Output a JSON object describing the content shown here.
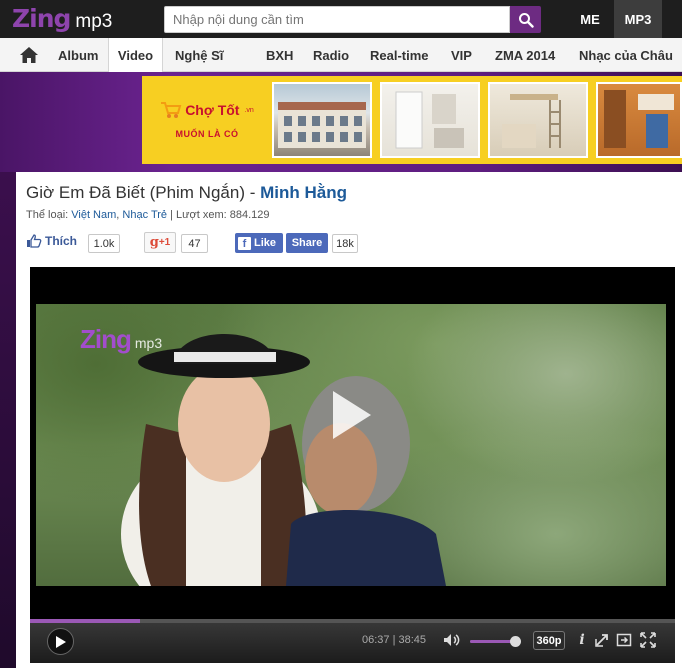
{
  "header": {
    "logo_brand": "Zing",
    "logo_product": "mp3",
    "search_placeholder": "Nhập nội dung cần tìm",
    "tabs": [
      {
        "label": "ME"
      },
      {
        "label": "MP3",
        "active": true
      }
    ]
  },
  "nav": {
    "items": [
      {
        "label": "Album"
      },
      {
        "label": "Video",
        "active": true
      },
      {
        "label": "Nghệ Sĩ"
      },
      {
        "label": "BXH"
      },
      {
        "label": "Radio"
      },
      {
        "label": "Real-time"
      },
      {
        "label": "VIP"
      },
      {
        "label": "ZMA 2014"
      },
      {
        "label": "Nhạc của Châu"
      }
    ]
  },
  "ad": {
    "brand": "Chợ Tốt",
    "brand_suffix": ".vn",
    "tagline": "MUỐN LÀ CÓ"
  },
  "video": {
    "title": "Giờ Em Đã Biết (Phim Ngắn)",
    "separator": " - ",
    "artist": "Minh Hằng",
    "meta_category_label": "Thể loại: ",
    "meta_categories": [
      "Việt Nam",
      "Nhạc Trẻ"
    ],
    "meta_category_sep": ", ",
    "meta_views_label": " | Lượt xem: ",
    "meta_views": "884.129"
  },
  "social": {
    "like_label": "Thích",
    "like_count": "1.0k",
    "gplus_label": "+1",
    "gplus_count": "47",
    "fb_like_label": "Like",
    "fb_share_label": "Share",
    "fb_count": "18k"
  },
  "player": {
    "watermark_brand": "Zing",
    "watermark_product": "mp3",
    "current_time": "06:37",
    "total_time": "38:45",
    "progress": 0.171,
    "volume": 0.95,
    "quality": "360p"
  },
  "colors": {
    "brand_purple": "#8e44ad",
    "link_blue": "#1d5a99",
    "facebook_blue": "#4c69ba",
    "ad_yellow": "#f7cf22"
  }
}
